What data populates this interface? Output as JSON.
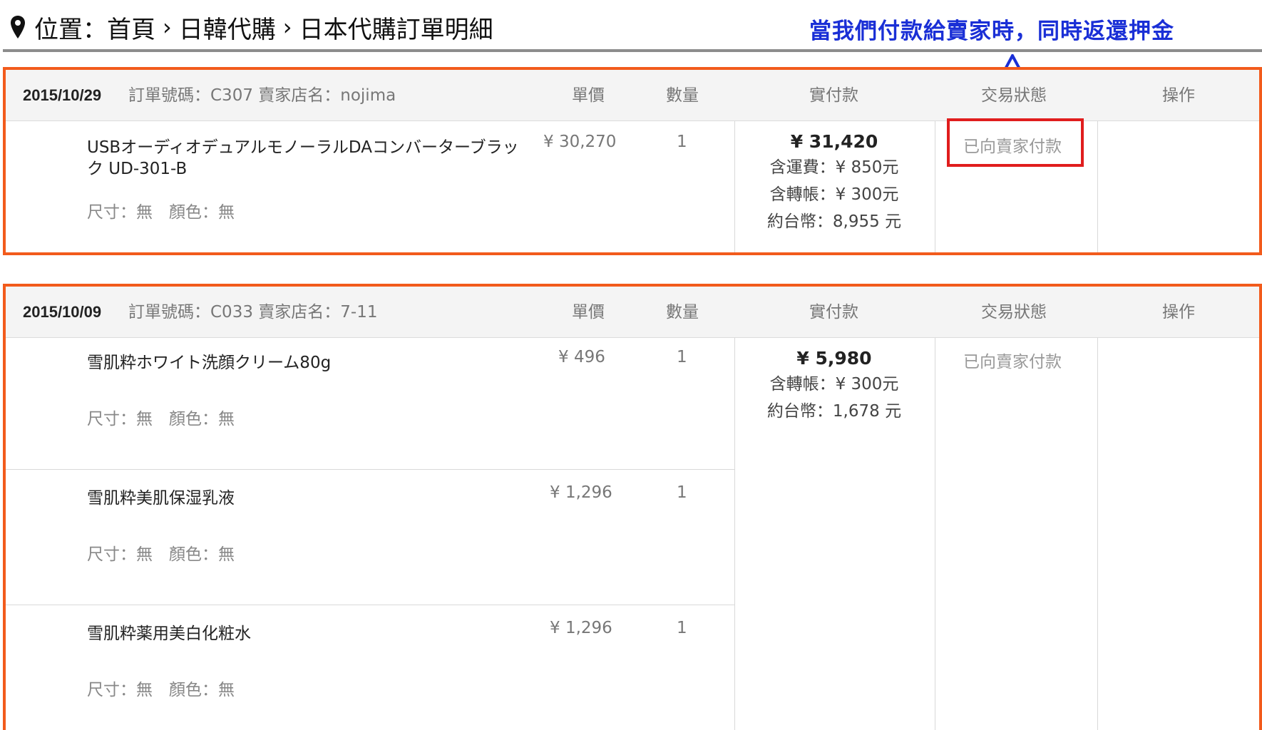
{
  "breadcrumb": {
    "location_label": "位置：",
    "items": [
      "首頁",
      "日韓代購",
      "日本代購訂單明細"
    ]
  },
  "annotation": "當我們付款給賣家時，同時返還押金",
  "columns": {
    "price": "單價",
    "qty": "數量",
    "paid": "實付款",
    "status": "交易狀態",
    "op": "操作"
  },
  "orders": [
    {
      "date": "2015/10/29",
      "meta": "訂單號碼：C307 賣家店名：nojima",
      "items": [
        {
          "name": "USBオーディオデュアルモノーラルDAコンバーターブラック UD-301-B",
          "spec": "尺寸：無　顏色：無",
          "price": "¥ 30,270",
          "qty": "1"
        }
      ],
      "payment": {
        "total": "¥ 31,420",
        "lines": [
          "含運費：¥ 850元",
          "含轉帳：¥ 300元",
          "約台幣：8,955 元"
        ]
      },
      "status": "已向賣家付款"
    },
    {
      "date": "2015/10/09",
      "meta": "訂單號碼：C033 賣家店名：7-11",
      "items": [
        {
          "name": "雪肌粋ホワイト洗顔クリーム80g",
          "spec": "尺寸：無　顏色：無",
          "price": "¥ 496",
          "qty": "1"
        },
        {
          "name": "雪肌粋美肌保湿乳液",
          "spec": "尺寸：無　顏色：無",
          "price": "¥ 1,296",
          "qty": "1"
        },
        {
          "name": "雪肌粋薬用美白化粧水",
          "spec": "尺寸：無　顏色：無",
          "price": "¥ 1,296",
          "qty": "1"
        }
      ],
      "payment": {
        "total": "¥ 5,980",
        "lines": [
          "含轉帳：¥ 300元",
          "約台幣：1,678 元"
        ]
      },
      "status": "已向賣家付款"
    }
  ],
  "colors": {
    "frame": "#f25b1c",
    "highlight": "#e01d1d",
    "annotation": "#1a2fd6"
  },
  "icons": {
    "location": "map-pin-icon",
    "separator": "chevron-right-icon",
    "arrow": "up-arrow-icon"
  }
}
